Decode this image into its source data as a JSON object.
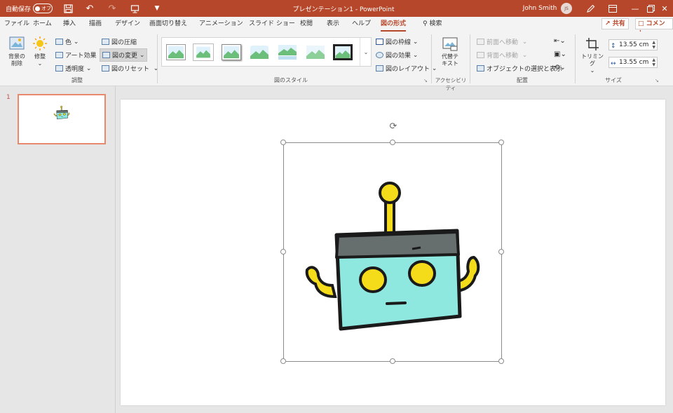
{
  "titlebar": {
    "autosave_label": "自動保存",
    "autosave_state": "オフ",
    "doc_title": "プレゼンテーション1  -  PowerPoint",
    "user_name": "John Smith",
    "user_initials": "JS",
    "bg_color": "#b7472a"
  },
  "tabs": [
    {
      "label": "ファイル"
    },
    {
      "label": "ホーム"
    },
    {
      "label": "挿入"
    },
    {
      "label": "描画"
    },
    {
      "label": "デザイン"
    },
    {
      "label": "画面切り替え"
    },
    {
      "label": "アニメーション"
    },
    {
      "label": "スライド ショー"
    },
    {
      "label": "校閲"
    },
    {
      "label": "表示"
    },
    {
      "label": "ヘルプ"
    },
    {
      "label": "図の形式",
      "active": true
    }
  ],
  "search_label": "検索",
  "share_label": "共有",
  "comment_label": "コメント",
  "ribbon": {
    "adjust": {
      "remove_bg": "背景の\n削除",
      "corrections": "修整",
      "color": "色",
      "artistic": "アート効果",
      "transparency": "透明度",
      "compress": "図の圧縮",
      "change": "図の変更",
      "reset": "図のリセット",
      "group_label": "調整"
    },
    "styles": {
      "border": "図の枠線",
      "effects": "図の効果",
      "layout": "図のレイアウト",
      "group_label": "図のスタイル"
    },
    "accessibility": {
      "alt_text": "代替テ\nキスト",
      "group_label": "アクセシビリティ"
    },
    "arrange": {
      "bring_forward": "前面へ移動",
      "send_backward": "背面へ移動",
      "selection_pane": "オブジェクトの選択と表示",
      "group_label": "配置"
    },
    "size": {
      "crop": "トリミング",
      "height": "13.55 cm",
      "width": "13.55 cm",
      "group_label": "サイズ"
    }
  },
  "slides_pane": {
    "slide_number": "1"
  },
  "colors": {
    "accent": "#b7472a",
    "robot_face": "#8ee8e0",
    "robot_top": "#666e6e",
    "robot_yellow": "#f5dc1b"
  }
}
